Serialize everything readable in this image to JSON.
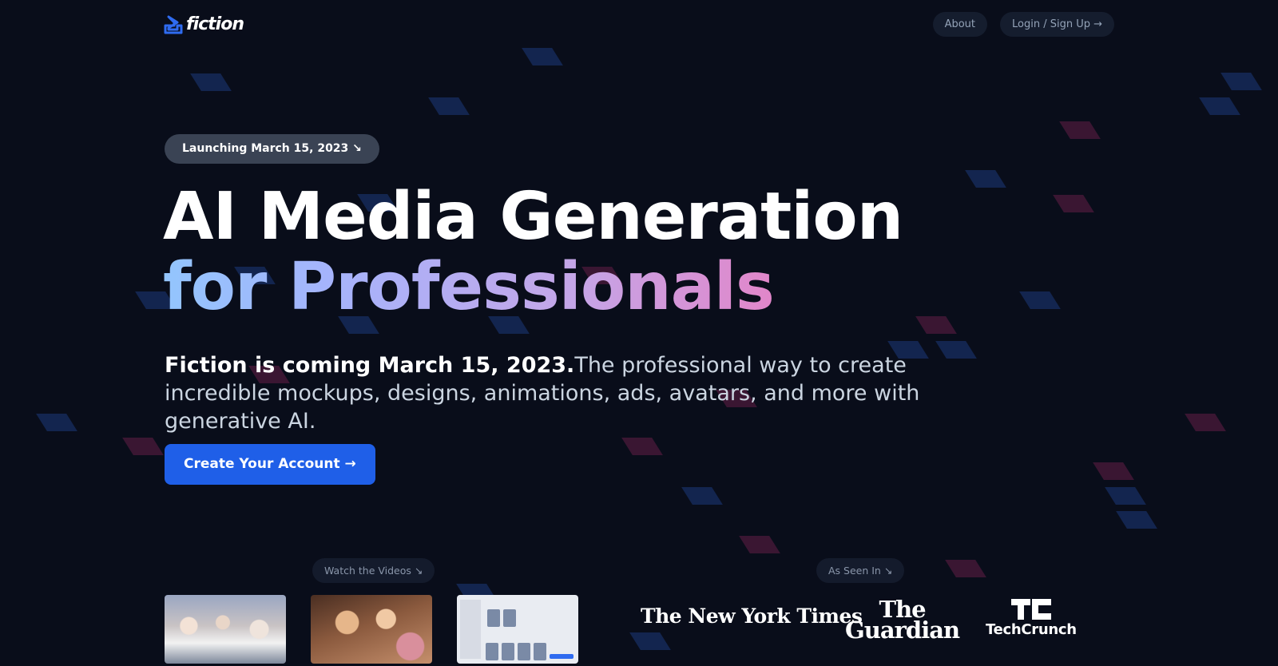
{
  "header": {
    "logo_text": "fiction",
    "nav": [
      {
        "label": "About"
      },
      {
        "label": "Login / Sign Up →"
      }
    ]
  },
  "hero": {
    "badge": "Launching March 15, 2023 ↘",
    "headline_line1": "AI Media Generation",
    "headline_line2": "for Professionals",
    "sub_bold": "Fiction is coming March 15, 2023.",
    "sub_rest": "The professional way to create incredible mockups, designs, animations, ads, avatars, and more with generative AI.",
    "cta": "Create Your Account →"
  },
  "videos": {
    "label": "Watch the Videos ↘"
  },
  "press": {
    "label": "As Seen In ↘",
    "logos": [
      "The New York Times",
      "The",
      "Guardian",
      "TechCrunch"
    ]
  },
  "colors": {
    "background": "#090d1a",
    "accent": "#1f5fe8",
    "gradient_start": "#93c5fd",
    "gradient_end": "#f472b6",
    "shape_blue": "#13254f",
    "shape_pink": "#3a1632"
  },
  "icons": {
    "logo": "fiction-logo-icon",
    "techcrunch": "techcrunch-tc-icon"
  }
}
